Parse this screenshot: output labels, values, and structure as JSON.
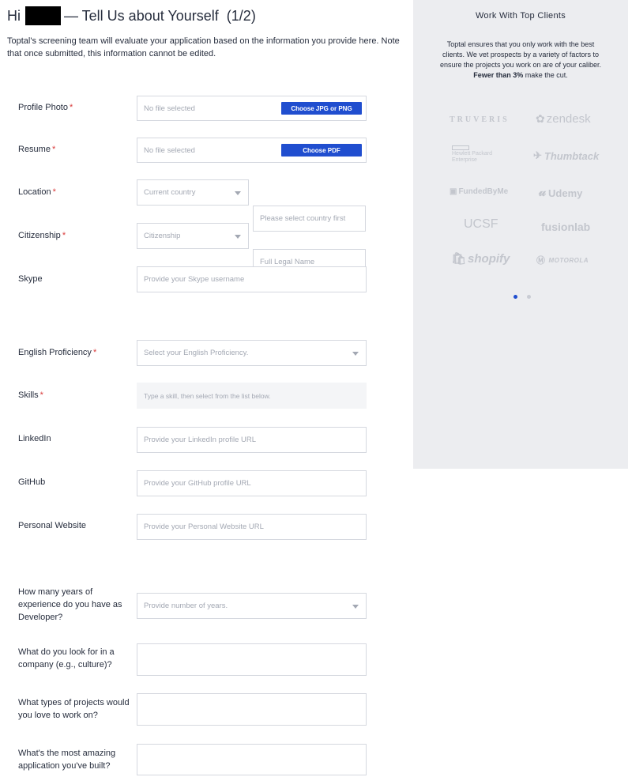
{
  "header": {
    "greeting": "Hi",
    "title_rest": "— Tell Us about Yourself",
    "step": "(1/2)",
    "intro": "Toptal's screening team will evaluate your application based on the information you provide here. Note that once submitted, this information cannot be edited."
  },
  "form": {
    "profile_photo": {
      "label": "Profile Photo",
      "required": "*",
      "status": "No file selected",
      "button": "Choose JPG or PNG"
    },
    "resume": {
      "label": "Resume",
      "required": "*",
      "status": "No file selected",
      "button": "Choose PDF"
    },
    "location": {
      "label": "Location",
      "required": "*",
      "country_placeholder": "Current country",
      "city_placeholder": "Please select country first"
    },
    "citizenship": {
      "label": "Citizenship",
      "required": "*",
      "select_placeholder": "Citizenship",
      "name_placeholder": "Full Legal Name"
    },
    "skype": {
      "label": "Skype",
      "placeholder": "Provide your Skype username"
    },
    "english": {
      "label": "English Proficiency",
      "required": "*",
      "placeholder": "Select your English Proficiency."
    },
    "skills": {
      "label": "Skills",
      "required": "*",
      "placeholder": "Type a skill, then select from the list below."
    },
    "linkedin": {
      "label": "LinkedIn",
      "placeholder": "Provide your LinkedIn profile URL"
    },
    "github": {
      "label": "GitHub",
      "placeholder": "Provide your GitHub profile URL"
    },
    "website": {
      "label": "Personal Website",
      "placeholder": "Provide your Personal Website URL"
    },
    "years": {
      "label": "How many years of experience do you have as Developer?",
      "placeholder": "Provide number of years."
    },
    "company": {
      "label": "What do you look for in a company (e.g., culture)?",
      "value": ""
    },
    "projects": {
      "label": "What types of projects would you love to work on?",
      "value": ""
    },
    "amazing": {
      "label": "What's the most amazing application you've built?",
      "value": ""
    }
  },
  "sidebar": {
    "title": "Work With Top Clients",
    "text": "Toptal ensures that you only work with the best clients. We vet prospects by a variety of factors to ensure the projects you work on are of your caliber.",
    "highlight": "Fewer than 3%",
    "highlight_rest": " make the cut.",
    "logos": {
      "truveris": "TRUVERIS",
      "zendesk": "zendesk",
      "hpe_line1": "Hewlett Packard",
      "hpe_line2": "Enterprise",
      "thumbtack": "Thumbtack",
      "fundedbyme": "FundedByMe",
      "udemy": "Udemy",
      "ucsf": "UCSF",
      "fusionlab": "fusionlab",
      "shopify": "shopify",
      "motorola": "MOTOROLA"
    },
    "carousel_active": 1,
    "carousel_count": 2
  }
}
